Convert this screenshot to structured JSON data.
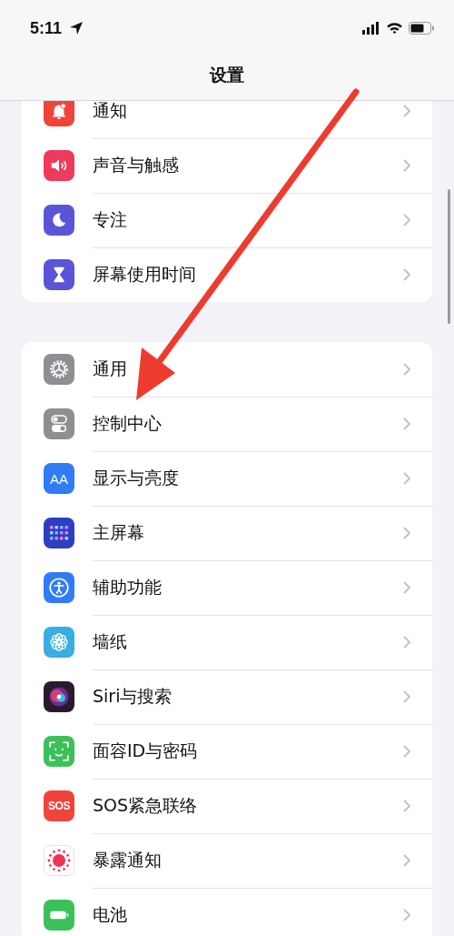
{
  "status_bar": {
    "time": "5:11"
  },
  "nav": {
    "title": "设置"
  },
  "groups": [
    {
      "items": [
        {
          "label": "通知",
          "kind": "bell",
          "color": "#f0443a"
        },
        {
          "label": "声音与触感",
          "kind": "speaker",
          "color": "#ee3b5b"
        },
        {
          "label": "专注",
          "kind": "moon",
          "color": "#5a55d6"
        },
        {
          "label": "屏幕使用时间",
          "kind": "hourglass",
          "color": "#5a55d6"
        }
      ]
    },
    {
      "items": [
        {
          "label": "通用",
          "kind": "gear",
          "color": "#8e8e93"
        },
        {
          "label": "控制中心",
          "kind": "toggles",
          "color": "#8e8e93"
        },
        {
          "label": "显示与亮度",
          "kind": "text",
          "icon_text": "AA",
          "color": "#2f7cf6"
        },
        {
          "label": "主屏幕",
          "kind": "grid",
          "color": "#2c3fc2"
        },
        {
          "label": "辅助功能",
          "kind": "accessibility",
          "color": "#2f7cf6"
        },
        {
          "label": "墙纸",
          "kind": "flower",
          "color": "#39aee0"
        },
        {
          "label": "Siri与搜索",
          "kind": "orb",
          "color": "#2a1a2e"
        },
        {
          "label": "面容ID与密码",
          "kind": "face",
          "color": "#3cc15a"
        },
        {
          "label": "SOS紧急联络",
          "kind": "text",
          "icon_text": "SOS",
          "color": "#f0443a"
        },
        {
          "label": "暴露通知",
          "kind": "dots",
          "color": "#ffffff"
        },
        {
          "label": "电池",
          "kind": "battery",
          "color": "#3cc15a"
        }
      ]
    }
  ]
}
